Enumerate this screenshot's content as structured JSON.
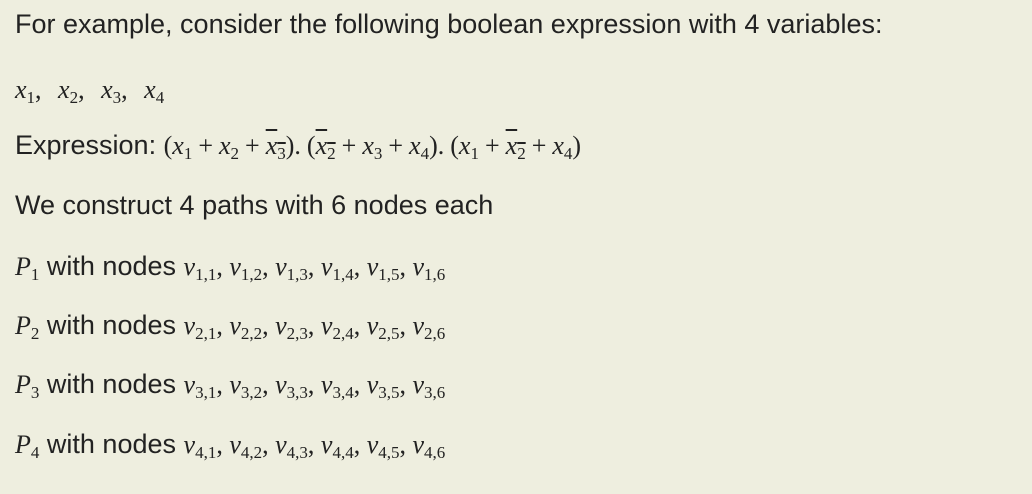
{
  "intro": "For example, consider the following boolean expression with 4 variables:",
  "variables": [
    {
      "name": "x",
      "index": "1"
    },
    {
      "name": "x",
      "index": "2"
    },
    {
      "name": "x",
      "index": "3"
    },
    {
      "name": "x",
      "index": "4"
    }
  ],
  "expression_label": "Expression:",
  "clauses": [
    [
      {
        "var": "x",
        "index": "1",
        "neg": false
      },
      {
        "var": "x",
        "index": "2",
        "neg": false
      },
      {
        "var": "x",
        "index": "3",
        "neg": true
      }
    ],
    [
      {
        "var": "x",
        "index": "2",
        "neg": true
      },
      {
        "var": "x",
        "index": "3",
        "neg": false
      },
      {
        "var": "x",
        "index": "4",
        "neg": false
      }
    ],
    [
      {
        "var": "x",
        "index": "1",
        "neg": false
      },
      {
        "var": "x",
        "index": "2",
        "neg": true
      },
      {
        "var": "x",
        "index": "4",
        "neg": false
      }
    ]
  ],
  "construction": "We construct 4 paths with 6 nodes each",
  "with_nodes": "with nodes",
  "paths": [
    {
      "name": "P",
      "index": "1",
      "nodes": [
        "1,1",
        "1,2",
        "1,3",
        "1,4",
        "1,5",
        "1,6"
      ]
    },
    {
      "name": "P",
      "index": "2",
      "nodes": [
        "2,1",
        "2,2",
        "2,3",
        "2,4",
        "2,5",
        "2,6"
      ]
    },
    {
      "name": "P",
      "index": "3",
      "nodes": [
        "3,1",
        "3,2",
        "3,3",
        "3,4",
        "3,5",
        "3,6"
      ]
    },
    {
      "name": "P",
      "index": "4",
      "nodes": [
        "4,1",
        "4,2",
        "4,3",
        "4,4",
        "4,5",
        "4,6"
      ]
    }
  ],
  "node_symbol": "v"
}
